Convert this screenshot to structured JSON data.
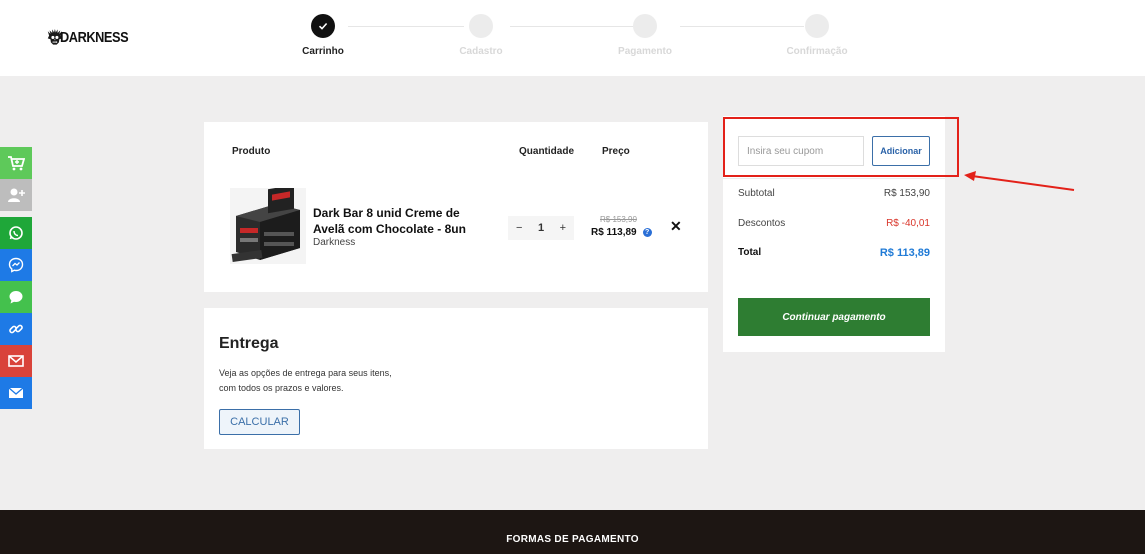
{
  "brand": {
    "name": "DARKNESS",
    "icon": "skull-icon"
  },
  "steps": [
    {
      "label": "Carrinho",
      "active": true
    },
    {
      "label": "Cadastro",
      "active": false
    },
    {
      "label": "Pagamento",
      "active": false
    },
    {
      "label": "Confirmação",
      "active": false
    }
  ],
  "sidebar": [
    {
      "icon": "cart-icon",
      "color": "#5ec95a"
    },
    {
      "icon": "add-user-icon",
      "color": "#bdbdbd"
    },
    {
      "icon": "whatsapp-icon",
      "color": "#1fa739"
    },
    {
      "icon": "messenger-icon",
      "color": "#1e7ae6"
    },
    {
      "icon": "chat-icon",
      "color": "#44c14d"
    },
    {
      "icon": "link-icon",
      "color": "#1e7ae6"
    },
    {
      "icon": "gmail-icon",
      "color": "#d9433a"
    },
    {
      "icon": "email-icon",
      "color": "#1e7ae6"
    }
  ],
  "cart": {
    "headers": {
      "product": "Produto",
      "quantity": "Quantidade",
      "price": "Preço"
    },
    "item": {
      "name": "Dark Bar 8 unid Creme de Avelã com Chocolate - 8un",
      "brand": "Darkness",
      "quantity": "1",
      "old_price": "R$ 153,90",
      "price": "R$ 113,89",
      "minus": "−",
      "plus": "+",
      "remove": "✕",
      "help": "?"
    }
  },
  "shipping": {
    "title": "Entrega",
    "line1": "Veja as opções de entrega para seus itens,",
    "line2": "com todos os prazos e valores.",
    "button": "CALCULAR"
  },
  "summary": {
    "coupon_placeholder": "Insira seu cupom",
    "coupon_button": "Adicionar",
    "subtotal_label": "Subtotal",
    "subtotal_value": "R$ 153,90",
    "discount_label": "Descontos",
    "discount_value": "R$ -40,01",
    "total_label": "Total",
    "total_value": "R$ 113,89",
    "pay_button": "Continuar pagamento"
  },
  "footer": {
    "title": "FORMAS DE PAGAMENTO"
  },
  "colors": {
    "accent": "#2e7d32",
    "highlight": "#e32119",
    "link": "#1f7ad6"
  }
}
